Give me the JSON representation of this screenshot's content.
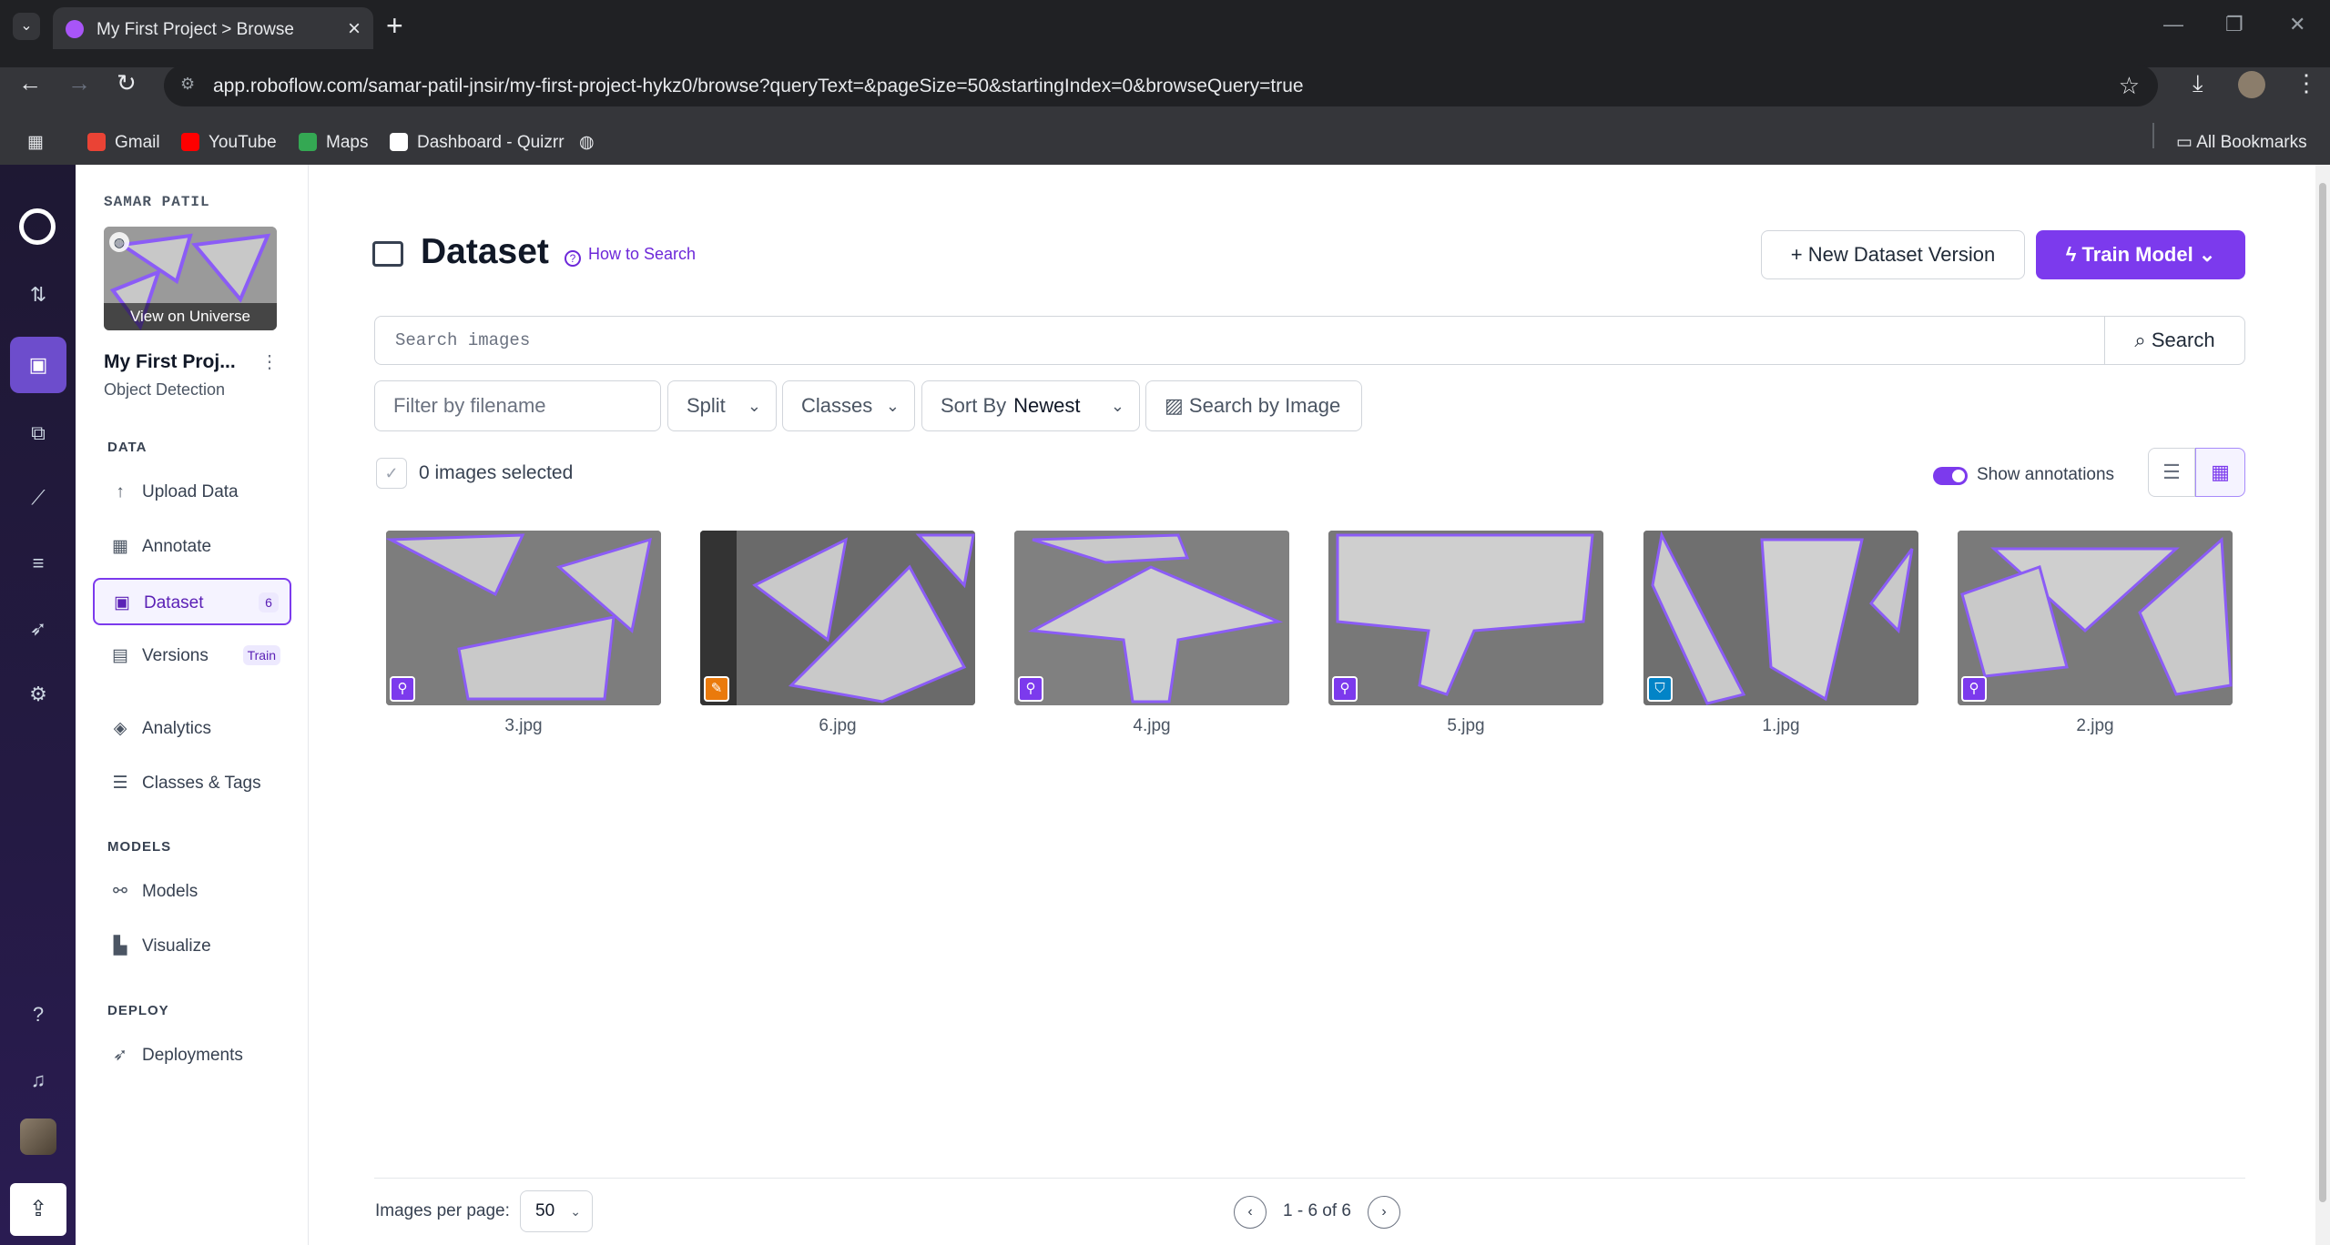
{
  "browser": {
    "tab_title": "My First Project > Browse",
    "url": "app.roboflow.com/samar-patil-jnsir/my-first-project-hykz0/browse?queryText=&pageSize=50&startingIndex=0&browseQuery=true",
    "bookmarks": [
      {
        "label": "Gmail",
        "color": "#ea4335"
      },
      {
        "label": "YouTube",
        "color": "#ff0000"
      },
      {
        "label": "Maps",
        "color": "#34a853"
      },
      {
        "label": "Dashboard - Quizrr",
        "color": "#ffffff"
      }
    ],
    "all_bookmarks": "All Bookmarks"
  },
  "sidebar": {
    "owner": "SAMAR PATIL",
    "view_universe": "View on Universe",
    "project_name": "My First Proj...",
    "project_type": "Object Detection",
    "sections": {
      "data": "DATA",
      "models": "MODELS",
      "deploy": "DEPLOY"
    },
    "items": {
      "upload": "Upload Data",
      "annotate": "Annotate",
      "dataset": "Dataset",
      "dataset_count": "6",
      "versions": "Versions",
      "versions_badge": "Train",
      "analytics": "Analytics",
      "classes": "Classes & Tags",
      "models": "Models",
      "visualize": "Visualize",
      "deployments": "Deployments"
    }
  },
  "main": {
    "title": "Dataset",
    "how_to_search": "How to Search",
    "new_version": "New Dataset Version",
    "train_model": "Train Model",
    "search_placeholder": "Search images",
    "search_button": "Search",
    "filters": {
      "filename_placeholder": "Filter by filename",
      "split": "Split",
      "classes": "Classes",
      "sort_by": "Sort By",
      "sort_value": "Newest",
      "search_by_image": "Search by Image"
    },
    "selected": "0 images selected",
    "show_annotations": "Show annotations",
    "images": [
      {
        "name": "3.jpg",
        "badge": "run",
        "badge_color": "#7c3aed"
      },
      {
        "name": "6.jpg",
        "badge": "pencil",
        "badge_color": "#ea7a0c"
      },
      {
        "name": "4.jpg",
        "badge": "run",
        "badge_color": "#7c3aed"
      },
      {
        "name": "5.jpg",
        "badge": "run",
        "badge_color": "#7c3aed"
      },
      {
        "name": "1.jpg",
        "badge": "shield",
        "badge_color": "#0284c7"
      },
      {
        "name": "2.jpg",
        "badge": "run",
        "badge_color": "#7c3aed"
      }
    ],
    "footer": {
      "per_page_label": "Images per page:",
      "per_page_value": "50",
      "range": "1 - 6 of 6"
    }
  },
  "colors": {
    "accent": "#7c3aed",
    "annotation": "#8b5cf6"
  }
}
